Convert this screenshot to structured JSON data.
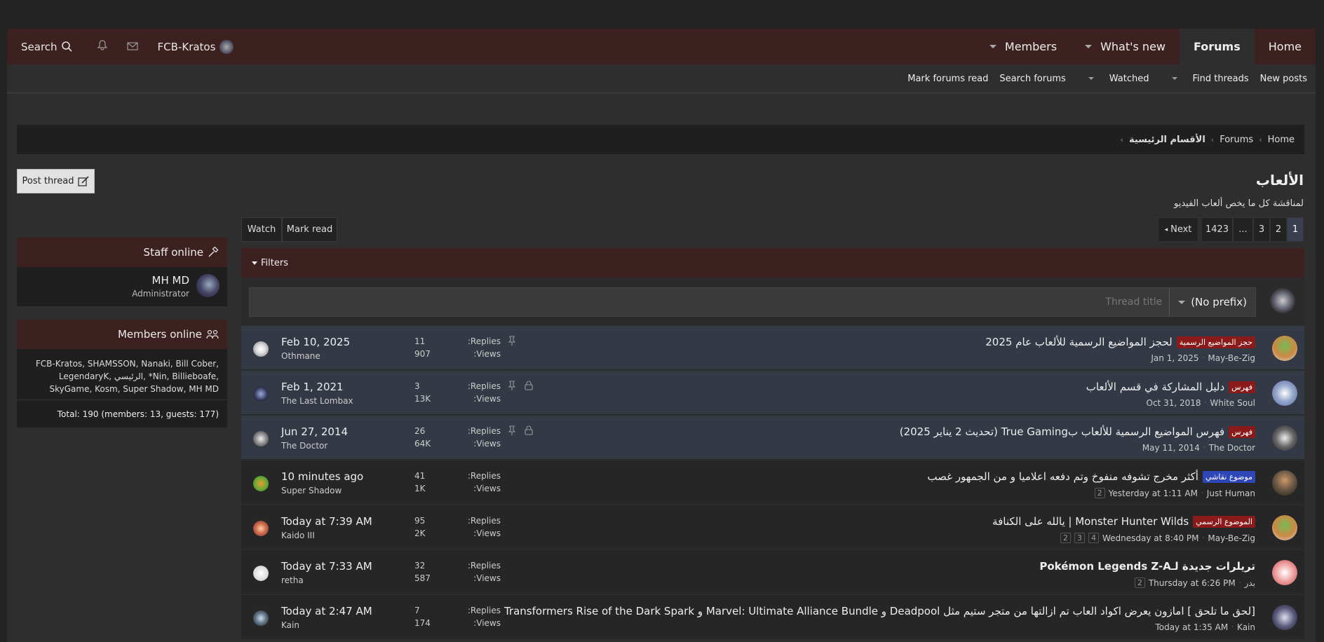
{
  "nav": {
    "search_label": "Search",
    "username": "FCB-Kratos",
    "tabs": [
      "Members",
      "What's new",
      "Forums",
      "Home"
    ]
  },
  "subnav": [
    "Mark forums read",
    "Search forums",
    "Watched",
    "Find threads",
    "New posts"
  ],
  "breadcrumb": [
    "Home",
    "Forums",
    "الأقسام الرئيسية"
  ],
  "post_thread": "Post thread",
  "forum": {
    "title": "الألعاب",
    "description": "لمناقشة كل ما يخص ألعاب الفيديو"
  },
  "watch": "Watch",
  "mark_read": "Mark read",
  "pagination": {
    "pages": [
      "1",
      "2",
      "3",
      "...",
      "1423"
    ],
    "next": "Next"
  },
  "filters_label": "Filters",
  "quick_thread": {
    "prefix": "(No prefix)",
    "placeholder": "Thread title"
  },
  "replies_label": "Replies:",
  "views_label": "Views:",
  "threads": [
    {
      "prefix": "حجز المواضيع الرسمية",
      "prefix_color": "red",
      "title": "لحجز المواضيع الرسمية للألعاب عام 2025",
      "date": "Jan 1, 2025",
      "author": "May-Be-Zig",
      "replies": "11",
      "views": "907",
      "last_date": "Feb 10, 2025",
      "last_user": "Othmane",
      "sticky": true,
      "locked": false,
      "pages": []
    },
    {
      "prefix": "فهرس",
      "prefix_color": "red",
      "title": "دليل المشاركة في قسم الألعاب",
      "date": "Oct 31, 2018",
      "author": "White Soul",
      "replies": "3",
      "views": "13K",
      "last_date": "Feb 1, 2021",
      "last_user": "The Last Lombax",
      "sticky": true,
      "locked": true,
      "pages": []
    },
    {
      "prefix": "فهرس",
      "prefix_color": "red",
      "title": "فهرس المواضيع الرسمية للألعاب بTrue Gaming (تحديث 2 يناير 2025)",
      "date": "May 11, 2014",
      "author": "The Doctor",
      "replies": "26",
      "views": "64K",
      "last_date": "Jun 27, 2014",
      "last_user": "The Doctor",
      "sticky": true,
      "locked": true,
      "pages": []
    },
    {
      "prefix": "موضوع نقاشي",
      "prefix_color": "blue",
      "title": "أكثر مخرج تشوفه منفوخ وتم دفعه اعلاميا و من الجمهور غصب",
      "date": "Yesterday at 1:11 AM",
      "author": "Just Human",
      "replies": "41",
      "views": "1K",
      "last_date": "10 minutes ago",
      "last_user": "Super Shadow",
      "sticky": false,
      "locked": false,
      "pages": [
        "2"
      ]
    },
    {
      "prefix": "الموضوع الرسمي",
      "prefix_color": "red",
      "title": "Monster Hunter Wilds | يالله على الكنافة",
      "date": "Wednesday at 8:40 PM",
      "author": "May-Be-Zig",
      "replies": "95",
      "views": "2K",
      "last_date": "Today at 7:39 AM",
      "last_user": "Kaido III",
      "sticky": false,
      "locked": false,
      "pages": [
        "2",
        "3",
        "4"
      ]
    },
    {
      "prefix": "",
      "prefix_color": "",
      "title": "تريلرات جديدة لـPokémon Legends Z-A",
      "date": "Thursday at 6:26 PM",
      "author": "بدر",
      "replies": "32",
      "views": "587",
      "last_date": "Today at 7:33 AM",
      "last_user": "retha",
      "sticky": false,
      "locked": false,
      "pages": [
        "2"
      ]
    },
    {
      "prefix": "",
      "prefix_color": "",
      "title": "[لحق ما تلحق ] امازون يعرض اكواد العاب تم ازالتها من متجر ستيم مثل Deadpool و Marvel: Ultimate Alliance Bundle و Transformers Rise of the Dark Spark",
      "date": "Today at 1:35 AM",
      "author": "Kain",
      "replies": "7",
      "views": "174",
      "last_date": "Today at 2:47 AM",
      "last_user": "Kain",
      "sticky": false,
      "locked": false,
      "pages": []
    }
  ],
  "staff": {
    "title": "Staff online",
    "name": "MH MD",
    "role": "Administrator"
  },
  "members_online": {
    "title": "Members online",
    "list_line1": "FCB-Kratos, SHAMSSON, Nanaki, Bill Cober,",
    "list_line2": "LegendaryK, الرئيسي, *Nin, Billieboafe,",
    "list_line3": "SkyGame, Kosm, Super Shadow, MH MD",
    "total": "Total: 190 (members: 13, guests: 177)"
  },
  "colors": {
    "accent": "#3d2020",
    "sticky_row": "#333945",
    "prefix_red": "#8b1a1a",
    "prefix_blue": "#2e47b8"
  }
}
